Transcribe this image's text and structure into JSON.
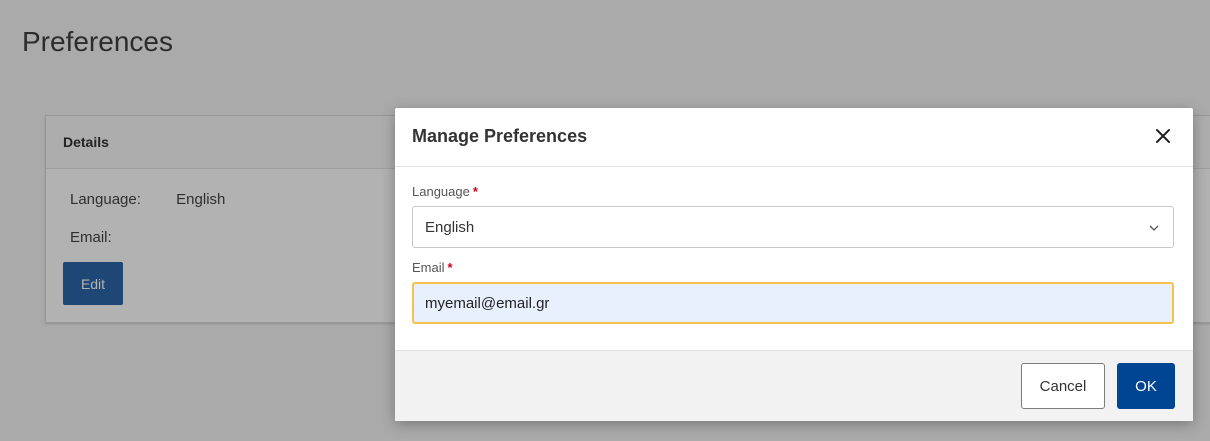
{
  "page": {
    "title": "Preferences"
  },
  "details": {
    "header": "Details",
    "language_label": "Language:",
    "language_value": "English",
    "email_label": "Email:",
    "email_value": "",
    "edit_label": "Edit"
  },
  "modal": {
    "title": "Manage Preferences",
    "close_icon": "close-icon",
    "language": {
      "label": "Language",
      "required_mark": "*",
      "selected": "English"
    },
    "email": {
      "label": "Email",
      "required_mark": "*",
      "value": "myemail@email.gr"
    },
    "cancel_label": "Cancel",
    "ok_label": "OK"
  },
  "colors": {
    "primary": "#004494",
    "edit_button": "#2b66a8",
    "focus_border": "#f5c24b",
    "required": "#d0021b"
  }
}
